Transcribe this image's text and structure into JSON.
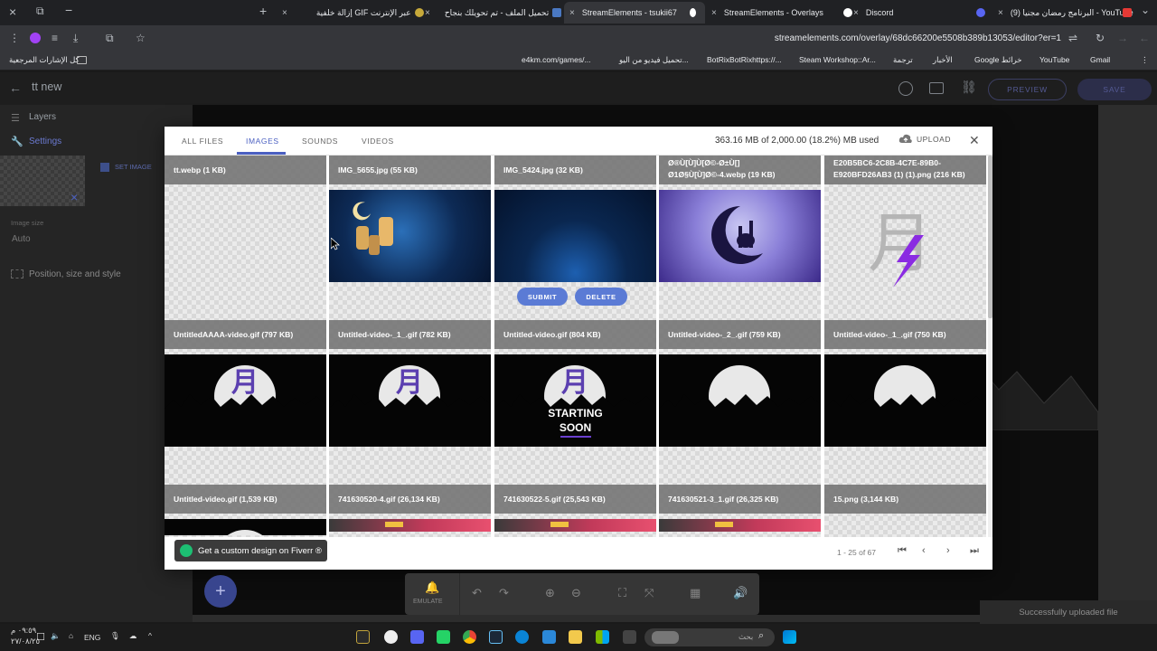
{
  "browser": {
    "tabs": [
      {
        "label": "(9) البرنامج رمضان مجنيا - YouTube"
      },
      {
        "label": "Discord"
      },
      {
        "label": "StreamElements - Overlays"
      },
      {
        "label": "StreamElements - tsukii67"
      },
      {
        "label": "تحميل الملف - تم تحويلك بنجاح"
      },
      {
        "label": "إزالة خلفية GIF عبر الإنترنت"
      }
    ],
    "url": "streamelements.com/overlay/68dc66200e5508b389b13053/editor?er=1",
    "bookmarks": [
      {
        "label": "كل الإشارات المرجعية"
      },
      {
        "label": "e4km.com/games/..."
      },
      {
        "label": "تحميل فيديو من اليو..."
      },
      {
        "label": "BotRixBotRixhttps://..."
      },
      {
        "label": "Steam Workshop::Ar..."
      },
      {
        "label": "ترجمة"
      },
      {
        "label": "الأخبار"
      },
      {
        "label": "Google خرائط"
      },
      {
        "label": "YouTube"
      },
      {
        "label": "Gmail"
      }
    ]
  },
  "editor": {
    "overlay_name": "tt new",
    "preview_label": "PREVIEW",
    "save_label": "SAVE",
    "layers_label": "Layers",
    "settings_label": "Settings",
    "set_image_label": "SET IMAGE",
    "image_size_label": "Image size",
    "image_size_value": "Auto",
    "position_label": "Position, size and style"
  },
  "modal": {
    "tabs": [
      "ALL FILES",
      "IMAGES",
      "SOUNDS",
      "VIDEOS"
    ],
    "active_tab": "IMAGES",
    "storage_text": "363.16 MB of 2,000.00 (18.2%) MB used",
    "upload_label": "UPLOAD",
    "submit_label": "SUBMIT",
    "delete_label": "DELETE",
    "files": [
      {
        "name": "tt.webp (1 KB)",
        "thumb": "transparent"
      },
      {
        "name": "IMG_5655.jpg (55 KB)",
        "thumb": "lanterns"
      },
      {
        "name": "IMG_5424.jpg (32 KB)",
        "thumb": "bluestage"
      },
      {
        "name": "Ø®Ù[Ù]Ù[Ø©-Ø±Ù[]\nØ1Ø§Ù[Ù]Ø©-4.webp (19 KB)",
        "thumb": "mosque"
      },
      {
        "name": "E20B5BC6-2C8B-4C7E-89B0-\nE920BFD26AB3 (1) (1).png (216 KB)",
        "thumb": "kanji"
      },
      {
        "name": "UntitledAAAA-video.gif (797 KB)",
        "thumb": "moonkanji"
      },
      {
        "name": "Untitled-video-_1_.gif (782 KB)",
        "thumb": "moonkanji"
      },
      {
        "name": "Untitled-video.gif (804 KB)",
        "thumb": "starting"
      },
      {
        "name": "Untitled-video-_2_.gif (759 KB)",
        "thumb": "moon"
      },
      {
        "name": "Untitled-video-_1_.gif (750 KB)",
        "thumb": "moon"
      },
      {
        "name": "Untitled-video.gif (1,539 KB)",
        "thumb": "moonpartial"
      },
      {
        "name": "741630520-4.gif (26,134 KB)",
        "thumb": "banner"
      },
      {
        "name": "741630522-5.gif (25,543 KB)",
        "thumb": "banner"
      },
      {
        "name": "741630521-3_1.gif (26,325 KB)",
        "thumb": "banner"
      },
      {
        "name": "15.png (3,144 KB)",
        "thumb": "transparent"
      }
    ],
    "starting_text_1": "STARTING",
    "starting_text_2": "SOON",
    "kanji_char": "月",
    "fiverr_label": "Get a custom design on Fiverr ®",
    "pagination_text": "1 - 25 of 67"
  },
  "toolbar": {
    "emulate_label": "EMULATE"
  },
  "toast": "Successfully uploaded file",
  "taskbar": {
    "time": "٠٩:٥٩ م",
    "date": "٢٧/٠٨/٢٥",
    "lang": "ENG",
    "search_placeholder": "بحث"
  },
  "colors": {
    "accent": "#4a5fc1",
    "pill": "#5b7bd5",
    "fiverr_green": "#1dbf73"
  }
}
